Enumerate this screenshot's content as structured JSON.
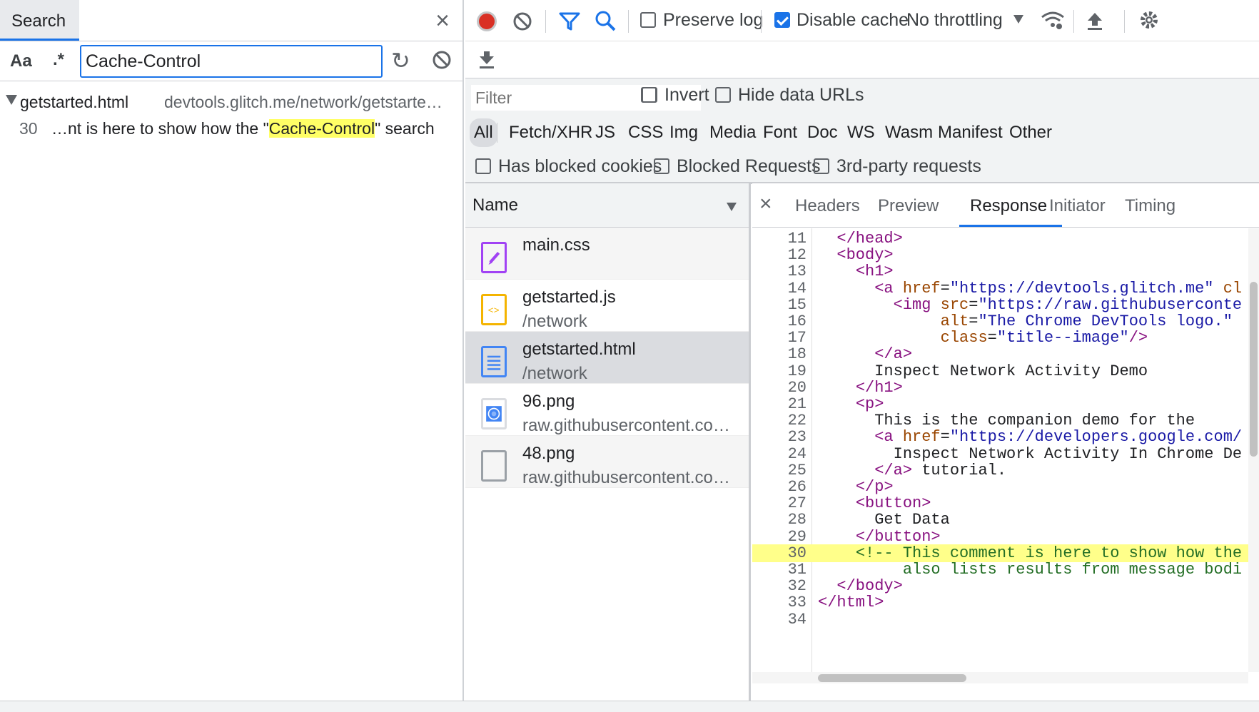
{
  "search_panel": {
    "tab_label": "Search",
    "case_label": "Aa",
    "regex_label": ".*",
    "query": "Cache-Control",
    "result_file": "getstarted.html",
    "result_path": "devtools.glitch.me/network/getstarte…",
    "result_line_no": "30",
    "result_prefix": "…nt is here to show how the \"",
    "result_match": "Cache-Control",
    "result_suffix": "\" search"
  },
  "toolbar": {
    "preserve_log": "Preserve log",
    "disable_cache": "Disable cache",
    "throttling": "No throttling"
  },
  "filter": {
    "placeholder": "Filter",
    "invert": "Invert",
    "hide_data_urls": "Hide data URLs",
    "types": [
      "All",
      "Fetch/XHR",
      "JS",
      "CSS",
      "Img",
      "Media",
      "Font",
      "Doc",
      "WS",
      "Wasm",
      "Manifest",
      "Other"
    ],
    "has_blocked_cookies": "Has blocked cookies",
    "blocked_requests": "Blocked Requests",
    "third_party": "3rd-party requests"
  },
  "requests": {
    "header": "Name",
    "items": [
      {
        "name": "main.css",
        "path": ""
      },
      {
        "name": "getstarted.js",
        "path": "/network"
      },
      {
        "name": "getstarted.html",
        "path": "/network"
      },
      {
        "name": "96.png",
        "path": "raw.githubusercontent.co…"
      },
      {
        "name": "48.png",
        "path": "raw.githubusercontent.co…"
      }
    ]
  },
  "details": {
    "tabs": [
      "Headers",
      "Preview",
      "Response",
      "Initiator",
      "Timing"
    ],
    "active_tab": "Response",
    "lines": [
      {
        "n": "11",
        "html": "  <span class='tg'>&lt;/head&gt;</span>"
      },
      {
        "n": "12",
        "html": "  <span class='tg'>&lt;body&gt;</span>"
      },
      {
        "n": "13",
        "html": "    <span class='tg'>&lt;h1&gt;</span>"
      },
      {
        "n": "14",
        "html": "      <span class='tg'>&lt;a</span> <span class='at'>href</span>=<span class='av'>\"https://devtools.glitch.me\"</span> <span class='at'>cl</span>"
      },
      {
        "n": "15",
        "html": "        <span class='tg'>&lt;img</span> <span class='at'>src</span>=<span class='av'>\"https://raw.githubuserconte</span>"
      },
      {
        "n": "16",
        "html": "             <span class='at'>alt</span>=<span class='av'>\"The Chrome DevTools logo.\"</span>"
      },
      {
        "n": "17",
        "html": "             <span class='at'>class</span>=<span class='av'>\"title--image\"</span><span class='tg'>/&gt;</span>"
      },
      {
        "n": "18",
        "html": "      <span class='tg'>&lt;/a&gt;</span>"
      },
      {
        "n": "19",
        "html": "      Inspect Network Activity Demo"
      },
      {
        "n": "20",
        "html": "    <span class='tg'>&lt;/h1&gt;</span>"
      },
      {
        "n": "21",
        "html": "    <span class='tg'>&lt;p&gt;</span>"
      },
      {
        "n": "22",
        "html": "      This is the companion demo for the"
      },
      {
        "n": "23",
        "html": "      <span class='tg'>&lt;a</span> <span class='at'>href</span>=<span class='av'>\"https://developers.google.com/</span>"
      },
      {
        "n": "24",
        "html": "        Inspect Network Activity In Chrome De"
      },
      {
        "n": "25",
        "html": "      <span class='tg'>&lt;/a&gt;</span> tutorial."
      },
      {
        "n": "26",
        "html": "    <span class='tg'>&lt;/p&gt;</span>"
      },
      {
        "n": "27",
        "html": "    <span class='tg'>&lt;button&gt;</span>"
      },
      {
        "n": "28",
        "html": "      Get Data"
      },
      {
        "n": "29",
        "html": "    <span class='tg'>&lt;/button&gt;</span>"
      },
      {
        "n": "30",
        "html": "    <span class='cm'>&lt;!-- This comment is here to show how the</span>",
        "highlight": true
      },
      {
        "n": "31",
        "html": "<span class='cm'>         also lists results from message bodi</span>"
      },
      {
        "n": "32",
        "html": "  <span class='tg'>&lt;/body&gt;</span>"
      },
      {
        "n": "33",
        "html": "<span class='tg'>&lt;/html&gt;</span>"
      },
      {
        "n": "34",
        "html": ""
      }
    ]
  },
  "colors": {
    "accent": "#1a73e8",
    "record": "#d93025",
    "highlight": "#ffff66"
  }
}
